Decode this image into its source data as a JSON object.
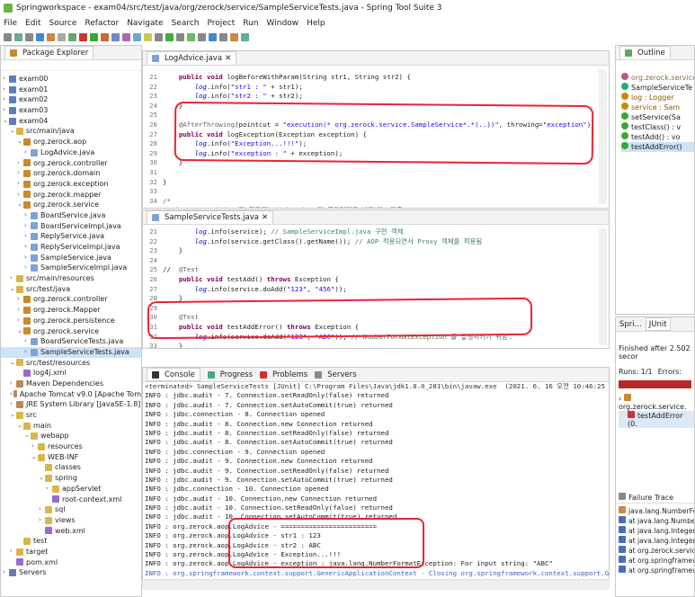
{
  "window": {
    "title": "Springworkspace - exam04/src/test/java/org/zerock/service/SampleServiceTests.java - Spring Tool Suite 3"
  },
  "menu": [
    "File",
    "Edit",
    "Source",
    "Refactor",
    "Navigate",
    "Search",
    "Project",
    "Run",
    "Window",
    "Help"
  ],
  "explorer": {
    "tab": "Package Explorer",
    "items": [
      {
        "indent": 0,
        "tw": "›",
        "icon": "proj",
        "label": "exam00"
      },
      {
        "indent": 0,
        "tw": "›",
        "icon": "proj",
        "label": "exam01"
      },
      {
        "indent": 0,
        "tw": "›",
        "icon": "proj",
        "label": "exam02"
      },
      {
        "indent": 0,
        "tw": "›",
        "icon": "proj",
        "label": "exam03"
      },
      {
        "indent": 0,
        "tw": "⌄",
        "icon": "proj",
        "label": "exam04"
      },
      {
        "indent": 1,
        "tw": "⌄",
        "icon": "fold",
        "label": "src/main/java"
      },
      {
        "indent": 2,
        "tw": "⌄",
        "icon": "pkg",
        "label": "org.zerock.aop"
      },
      {
        "indent": 3,
        "tw": "›",
        "icon": "jfile",
        "label": "LogAdvice.java"
      },
      {
        "indent": 2,
        "tw": "›",
        "icon": "pkg",
        "label": "org.zerock.controller"
      },
      {
        "indent": 2,
        "tw": "›",
        "icon": "pkg",
        "label": "org.zerock.domain"
      },
      {
        "indent": 2,
        "tw": "›",
        "icon": "pkg",
        "label": "org.zerock.exception"
      },
      {
        "indent": 2,
        "tw": "›",
        "icon": "pkg",
        "label": "org.zerock.mapper"
      },
      {
        "indent": 2,
        "tw": "⌄",
        "icon": "pkg",
        "label": "org.zerock.service"
      },
      {
        "indent": 3,
        "tw": "›",
        "icon": "jfile",
        "label": "BoardService.java"
      },
      {
        "indent": 3,
        "tw": "›",
        "icon": "jfile",
        "label": "BoardServiceImpl.java"
      },
      {
        "indent": 3,
        "tw": "›",
        "icon": "jfile",
        "label": "ReplyService.java"
      },
      {
        "indent": 3,
        "tw": "›",
        "icon": "jfile",
        "label": "ReplyServiceImpl.java"
      },
      {
        "indent": 3,
        "tw": "›",
        "icon": "jfile",
        "label": "SampleService.java"
      },
      {
        "indent": 3,
        "tw": "›",
        "icon": "jfile",
        "label": "SampleServiceImpl.java"
      },
      {
        "indent": 1,
        "tw": "›",
        "icon": "fold",
        "label": "src/main/resources"
      },
      {
        "indent": 1,
        "tw": "⌄",
        "icon": "fold",
        "label": "src/test/java"
      },
      {
        "indent": 2,
        "tw": "›",
        "icon": "pkg",
        "label": "org.zerock.controller"
      },
      {
        "indent": 2,
        "tw": "›",
        "icon": "pkg",
        "label": "org.zerock.Mapper"
      },
      {
        "indent": 2,
        "tw": "›",
        "icon": "pkg",
        "label": "org.zerock.persistence"
      },
      {
        "indent": 2,
        "tw": "⌄",
        "icon": "pkg",
        "label": "org.zerock.service"
      },
      {
        "indent": 3,
        "tw": "›",
        "icon": "jfile",
        "label": "BoardServiceTests.java"
      },
      {
        "indent": 3,
        "tw": "›",
        "icon": "jfile",
        "label": "SampleServiceTests.java",
        "selected": true
      },
      {
        "indent": 1,
        "tw": "⌄",
        "icon": "fold",
        "label": "src/test/resources"
      },
      {
        "indent": 2,
        "tw": "",
        "icon": "xml",
        "label": "log4j.xml"
      },
      {
        "indent": 1,
        "tw": "›",
        "icon": "jar",
        "label": "Maven Dependencies"
      },
      {
        "indent": 1,
        "tw": "›",
        "icon": "jar",
        "label": "Apache Tomcat v9.0 [Apache Tom"
      },
      {
        "indent": 1,
        "tw": "›",
        "icon": "jar",
        "label": "JRE System Library [JavaSE-1.8]"
      },
      {
        "indent": 1,
        "tw": "⌄",
        "icon": "fold",
        "label": "src"
      },
      {
        "indent": 2,
        "tw": "⌄",
        "icon": "fold",
        "label": "main"
      },
      {
        "indent": 3,
        "tw": "⌄",
        "icon": "fold",
        "label": "webapp"
      },
      {
        "indent": 4,
        "tw": "›",
        "icon": "fold",
        "label": "resources"
      },
      {
        "indent": 4,
        "tw": "⌄",
        "icon": "fold",
        "label": "WEB-INF"
      },
      {
        "indent": 5,
        "tw": "",
        "icon": "fold",
        "label": "classes"
      },
      {
        "indent": 5,
        "tw": "⌄",
        "icon": "fold",
        "label": "spring"
      },
      {
        "indent": 6,
        "tw": "›",
        "icon": "fold",
        "label": "appServlet"
      },
      {
        "indent": 6,
        "tw": "",
        "icon": "xml",
        "label": "root-context.xml"
      },
      {
        "indent": 5,
        "tw": "›",
        "icon": "fold",
        "label": "sql"
      },
      {
        "indent": 5,
        "tw": "›",
        "icon": "fold",
        "label": "views"
      },
      {
        "indent": 5,
        "tw": "",
        "icon": "xml",
        "label": "web.xml"
      },
      {
        "indent": 2,
        "tw": "",
        "icon": "fold",
        "label": "test"
      },
      {
        "indent": 1,
        "tw": "›",
        "icon": "fold",
        "label": "target"
      },
      {
        "indent": 1,
        "tw": "",
        "icon": "xml",
        "label": "pom.xml"
      },
      {
        "indent": 0,
        "tw": "›",
        "icon": "proj",
        "label": "Servers"
      }
    ]
  },
  "editor1": {
    "tab": "LogAdvice.java",
    "lines": [
      {
        "n": "21",
        "html": "    <span class='kw'>public void</span> logBeforeWithParam(String str1, String str2) {"
      },
      {
        "n": "22",
        "html": "        <span class='fld'>log</span>.info(<span class='str'>\"str1 : \"</span> + str1);"
      },
      {
        "n": "23",
        "html": "        <span class='fld'>log</span>.info(<span class='str'>\"str2 : \"</span> + str2);"
      },
      {
        "n": "24",
        "html": "    }"
      },
      {
        "n": "25",
        "html": ""
      },
      {
        "n": "26",
        "html": "    <span class='ann'>@AfterThrowing</span>(pointcut = <span class='str'>\"execution(* org.zerock.service.SampleService*.*(..))\"</span>, throwing=<span class='str'>\"exception\"</span>)"
      },
      {
        "n": "27",
        "html": "    <span class='kw'>public void</span> logException(Exception exception) {"
      },
      {
        "n": "28",
        "html": "        <span class='fld'>log</span>.info(<span class='str'>\"Exception...!!!\"</span>);"
      },
      {
        "n": "29",
        "html": "        <span class='fld'>log</span>.info(<span class='str'>\"exception : \"</span> + exception);"
      },
      {
        "n": "30",
        "html": "    }"
      },
      {
        "n": "31",
        "html": ""
      },
      {
        "n": "32",
        "html": "}"
      },
      {
        "n": "33",
        "html": ""
      },
      {
        "n": "34",
        "html": "<span class='cm'>/*</span>"
      },
      {
        "n": "35",
        "html": "<span class='cm'> <u>pointcut</u> : Advice 가 적용되는 joinPoint 가 무엇인지를 나타내는 기준</span>"
      }
    ]
  },
  "editor2": {
    "tab": "SampleServiceTests.java",
    "lines": [
      {
        "n": "21",
        "html": "        <span class='fld'>log</span>.info(service); <span class='cm'>// SampleServiceImpl.java 구현 객체</span>"
      },
      {
        "n": "22",
        "html": "        <span class='fld'>log</span>.info(service.getClass().getName()); <span class='cm'>// AOP 적용되면서 Proxy 객체를 적용됨</span>"
      },
      {
        "n": "23",
        "html": "    }"
      },
      {
        "n": "24",
        "html": ""
      },
      {
        "n": "25",
        "html": "//  <span class='ann'>@Test</span>"
      },
      {
        "n": "26",
        "html": "    <span class='kw'>public void</span> testAdd() <span class='kw'>throws</span> Exception {"
      },
      {
        "n": "27",
        "html": "        <span class='fld'>log</span>.info(service.doAdd(<span class='str'>\"123\"</span>, <span class='str'>\"456\"</span>));"
      },
      {
        "n": "28",
        "html": "    }"
      },
      {
        "n": "29",
        "html": ""
      },
      {
        "n": "30",
        "html": "    <span class='ann'>@Test</span>"
      },
      {
        "n": "31",
        "html": "    <span class='kw'>public void</span> testAddError() <span class='kw'>throws</span> Exception {"
      },
      {
        "n": "32",
        "html": "        <span class='fld'>log</span>.info(service.doAdd(<span class='str'>\"123\"</span>, <span class='str'>\"ABC\"</span>)); <span class='cm'>// NumberFormatException 을 발생시키기 위함.</span>"
      },
      {
        "n": "33",
        "html": "    }"
      },
      {
        "n": "34",
        "html": "}"
      },
      {
        "n": "35",
        "html": ""
      }
    ]
  },
  "console": {
    "tabs": [
      "Console",
      "Progress",
      "Problems",
      "Servers"
    ],
    "header": "<terminated> SampleServiceTests [JUnit] C:\\Program Files\\Java\\jdk1.8.0_281\\bin\\javaw.exe  (2021. 6. 16 오전 10:46:25 – 오전 10:46:29)",
    "lines": [
      {
        "t": "INFO : jdbc.audit - 7. Connection.setReadOnly(false) returned"
      },
      {
        "t": "INFO : jdbc.audit - 7. Connection.setAutoCommit(true) returned"
      },
      {
        "t": "INFO : jdbc.connection - 8. Connection opened"
      },
      {
        "t": "INFO : jdbc.audit - 8. Connection.new Connection returned"
      },
      {
        "t": "INFO : jdbc.audit - 8. Connection.setReadOnly(false) returned"
      },
      {
        "t": "INFO : jdbc.audit - 8. Connection.setAutoCommit(true) returned"
      },
      {
        "t": "INFO : jdbc.connection - 9. Connection opened"
      },
      {
        "t": "INFO : jdbc.audit - 9. Connection.new Connection returned"
      },
      {
        "t": "INFO : jdbc.audit - 9. Connection.setReadOnly(false) returned"
      },
      {
        "t": "INFO : jdbc.audit - 9. Connection.setAutoCommit(true) returned"
      },
      {
        "t": "INFO : jdbc.connection - 10. Connection opened"
      },
      {
        "t": "INFO : jdbc.audit - 10. Connection.new Connection returned"
      },
      {
        "t": "INFO : jdbc.audit - 10. Connection.setReadOnly(false) returned"
      },
      {
        "t": "INFO : jdbc.audit - 10. Connection.setAutoCommit(true) returned"
      },
      {
        "t": "INFO : org.zerock.aop.LogAdvice - ========================"
      },
      {
        "t": "INFO : org.zerock.aop.LogAdvice - str1 : 123"
      },
      {
        "t": "INFO : org.zerock.aop.LogAdvice - str2 : ABC"
      },
      {
        "t": "INFO : org.zerock.aop.LogAdvice - Exception...!!!"
      },
      {
        "t": "INFO : org.zerock.aop.LogAdvice - exception : java.lang.NumberFormatException: For input string: \"ABC\""
      },
      {
        "t": "INFO : org.springframework.context.support.GenericApplicationContext - Closing org.springframework.context.support.G",
        "c": "#3a5fcd"
      },
      {
        "t": "INFO : com.zaxxer.hikari.HikariDataSource - HikariPool-1 - Shutdown initiated...",
        "c": "#3a5fcd"
      },
      {
        "t": "INFO : jdbc.connection - 1. Connection closed",
        "c": "#3a5fcd"
      }
    ]
  },
  "outline": {
    "tab": "Outline",
    "items": [
      {
        "label": "org.zerock.service",
        "color": "#8a6d3b"
      },
      {
        "label": "SampleServiceTe",
        "color": "#222"
      },
      {
        "label": "log : Logger",
        "color": "#8a5a00"
      },
      {
        "label": "service : Sam",
        "color": "#8a5a00"
      },
      {
        "label": "setService(Sa",
        "color": "#222"
      },
      {
        "label": "testClass() : v",
        "color": "#222"
      },
      {
        "label": "testAdd() : vo",
        "color": "#222"
      },
      {
        "label": "testAddError()",
        "color": "#222"
      }
    ]
  },
  "junit": {
    "tabs": [
      "Spri...",
      "JUnit"
    ],
    "finished": "Finished after 2.502 secor",
    "runs": "Runs: 1/1",
    "errors": "Errors:",
    "tree1": "org.zerock.service.",
    "tree2": "testAddError (0.",
    "failure_trace": "Failure Trace",
    "trace": [
      "java.lang.NumberFormat",
      "at java.lang.NumberF",
      "at java.lang.Integer.pa",
      "at java.lang.Integer.pa",
      "at org.zerock.service.",
      "at org.springframewo",
      "at org.springframewo"
    ]
  }
}
